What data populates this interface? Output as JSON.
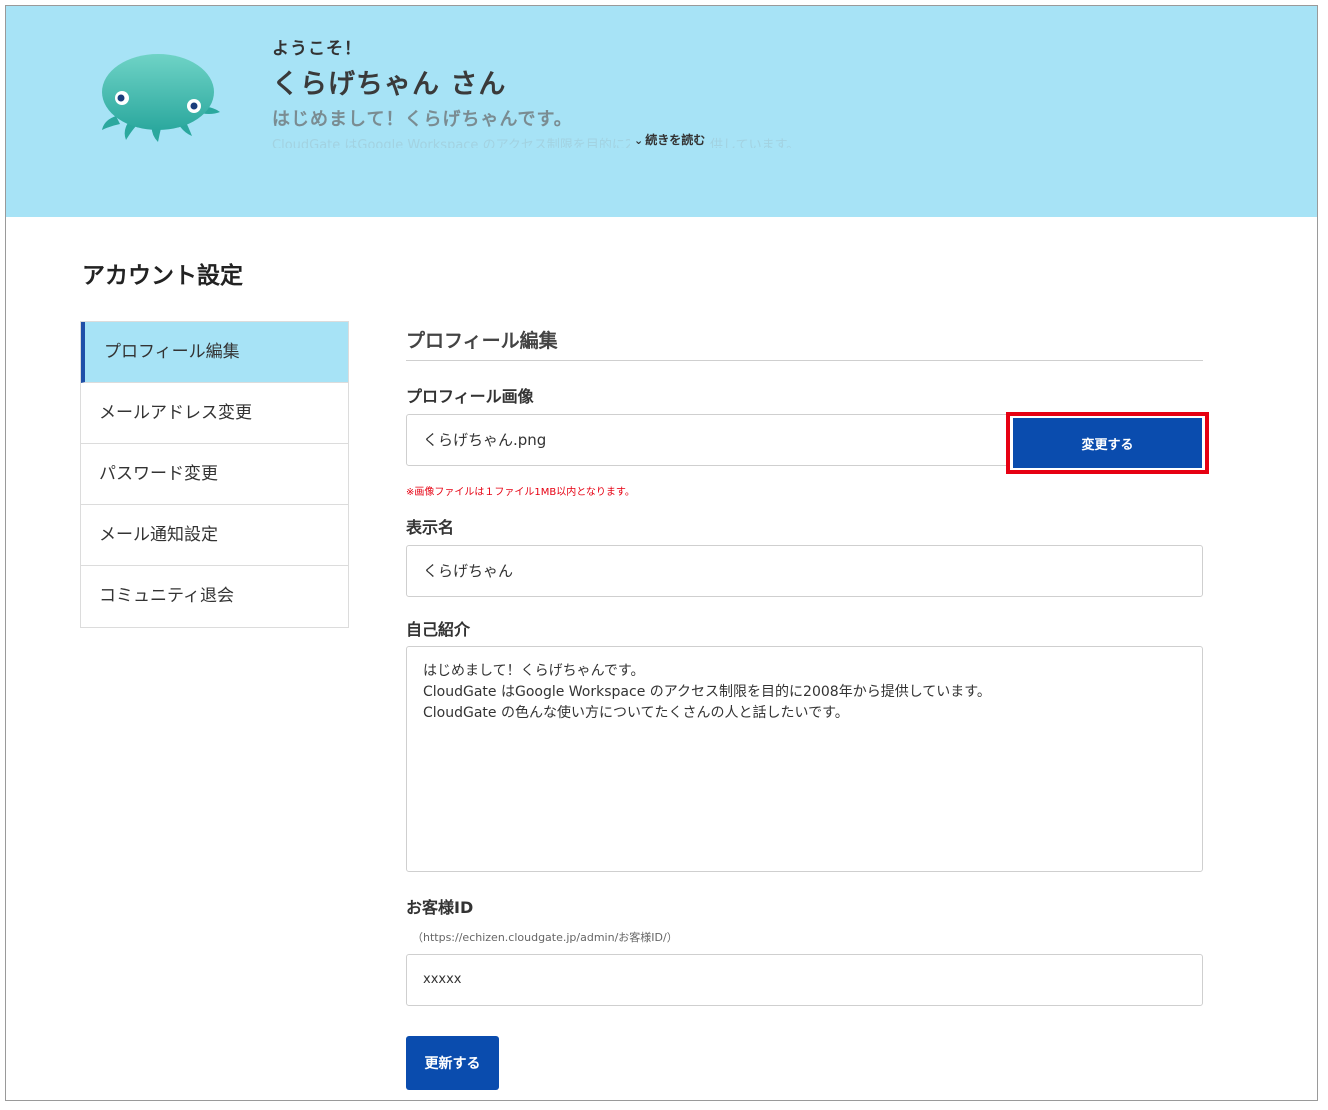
{
  "header": {
    "welcome": "ようこそ！",
    "username": "くらげちゃん さん",
    "bio_preview": "はじめまして！くらげちゃんです。",
    "bio_faded": "CloudGate はGoogle Workspace のアクセス制限を目的に2008年から提供しています。",
    "read_more": "続きを読む",
    "avatar_color": "#3fb8ac"
  },
  "page_title": "アカウント設定",
  "sidebar": {
    "items": [
      {
        "label": "プロフィール編集",
        "active": true
      },
      {
        "label": "メールアドレス変更",
        "active": false
      },
      {
        "label": "パスワード変更",
        "active": false
      },
      {
        "label": "メール通知設定",
        "active": false
      },
      {
        "label": "コミュニティ退会",
        "active": false
      }
    ]
  },
  "form": {
    "section_title": "プロフィール編集",
    "profile_image": {
      "label": "プロフィール画像",
      "value": "くらげちゃん.png",
      "change_button": "変更する",
      "warning": "※画像ファイルは１ファイル1MB以内となります。"
    },
    "display_name": {
      "label": "表示名",
      "value": "くらげちゃん"
    },
    "bio": {
      "label": "自己紹介",
      "value": "はじめまして！くらげちゃんです。\nCloudGate はGoogle Workspace のアクセス制限を目的に2008年から提供しています。\nCloudGate の色んな使い方についてたくさんの人と話したいです。"
    },
    "customer_id": {
      "label": "お客様ID",
      "hint": "（https://echizen.cloudgate.jp/admin/お客様ID/）",
      "value": "xxxxx"
    },
    "submit_button": "更新する"
  },
  "colors": {
    "header_bg": "#a7e3f6",
    "primary": "#0a4cae",
    "highlight": "#e60012"
  }
}
